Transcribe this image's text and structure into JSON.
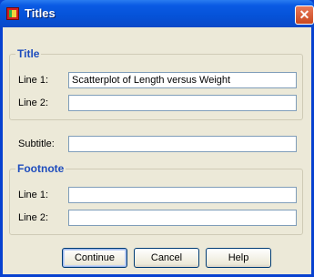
{
  "window": {
    "title": "Titles",
    "close_glyph": "✕"
  },
  "title_group": {
    "legend": "Title",
    "line1_label": "Line 1:",
    "line1_value": "Scatterplot of Length versus Weight",
    "line2_label": "Line 2:",
    "line2_value": ""
  },
  "subtitle": {
    "label": "Subtitle:",
    "value": ""
  },
  "footnote_group": {
    "legend": "Footnote",
    "line1_label": "Line 1:",
    "line1_value": "",
    "line2_label": "Line 2:",
    "line2_value": ""
  },
  "buttons": {
    "continue": "Continue",
    "cancel": "Cancel",
    "help": "Help"
  },
  "colors": {
    "title_bar": "#0a5ae4",
    "group_title": "#1f4dbd",
    "dialog_bg": "#ece9d8"
  }
}
